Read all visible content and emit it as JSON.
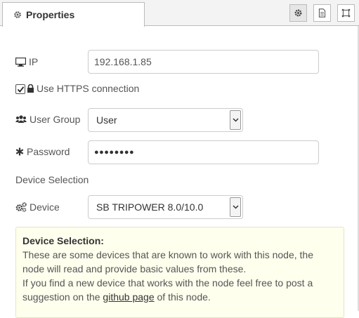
{
  "tabs": {
    "properties_label": "Properties"
  },
  "toolbar": {
    "buttons": [
      {
        "icon": "gear-icon",
        "active": true
      },
      {
        "icon": "document-icon",
        "active": false
      },
      {
        "icon": "frame-icon",
        "active": false
      }
    ]
  },
  "form": {
    "ip": {
      "label": "IP",
      "value": "192.168.1.85",
      "icon": "monitor-icon"
    },
    "https": {
      "label": "Use HTTPS connection",
      "checked": true,
      "icon": "lock-icon"
    },
    "user_group": {
      "label": "User Group",
      "value": "User",
      "icon": "users-icon"
    },
    "password": {
      "label": "Password",
      "value": "●●●●●●●●",
      "icon": "asterisk-icon"
    },
    "section_title": "Device Selection",
    "device": {
      "label": "Device",
      "value": "SB TRIPOWER 8.0/10.0",
      "icon": "cogs-icon"
    }
  },
  "help": {
    "title": "Device Selection:",
    "para1": "These are some devices that are known to work with this node, the node will read and provide basic values from these.",
    "para2_before": "If you find a new device that works with the node feel free to post a suggestion on the ",
    "link_text": "github page",
    "para2_after": " of this node."
  },
  "colors": {
    "help_background": "#ffffee",
    "border": "#cccccc",
    "text": "#555555"
  }
}
